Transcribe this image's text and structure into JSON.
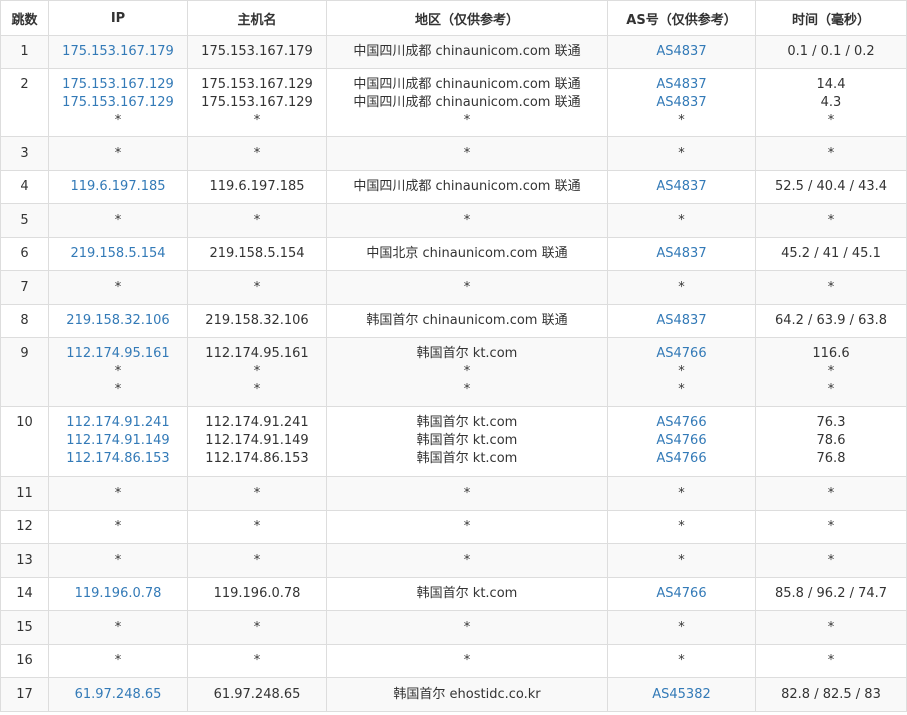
{
  "table": {
    "headers": [
      "跳数",
      "IP",
      "主机名",
      "地区（仅供参考）",
      "AS号（仅供参考）",
      "时间（毫秒）"
    ],
    "rows": [
      {
        "hop": "1",
        "ip": [
          "175.153.167.179"
        ],
        "host": [
          "175.153.167.179"
        ],
        "region": [
          "中国四川成都 chinaunicom.com 联通"
        ],
        "asn": [
          "AS4837"
        ],
        "time": [
          "0.1 / 0.1 / 0.2"
        ]
      },
      {
        "hop": "2",
        "ip": [
          "175.153.167.129",
          "175.153.167.129",
          "*"
        ],
        "host": [
          "175.153.167.129",
          "175.153.167.129",
          "*"
        ],
        "region": [
          "中国四川成都 chinaunicom.com 联通",
          "中国四川成都 chinaunicom.com 联通",
          "*"
        ],
        "asn": [
          "AS4837",
          "AS4837",
          "*"
        ],
        "time": [
          "14.4",
          "4.3",
          "*"
        ]
      },
      {
        "hop": "3",
        "ip": [
          "*"
        ],
        "host": [
          "*"
        ],
        "region": [
          "*"
        ],
        "asn": [
          "*"
        ],
        "time": [
          "*"
        ]
      },
      {
        "hop": "4",
        "ip": [
          "119.6.197.185"
        ],
        "host": [
          "119.6.197.185"
        ],
        "region": [
          "中国四川成都 chinaunicom.com 联通"
        ],
        "asn": [
          "AS4837"
        ],
        "time": [
          "52.5 / 40.4 / 43.4"
        ]
      },
      {
        "hop": "5",
        "ip": [
          "*"
        ],
        "host": [
          "*"
        ],
        "region": [
          "*"
        ],
        "asn": [
          "*"
        ],
        "time": [
          "*"
        ]
      },
      {
        "hop": "6",
        "ip": [
          "219.158.5.154"
        ],
        "host": [
          "219.158.5.154"
        ],
        "region": [
          "中国北京 chinaunicom.com 联通"
        ],
        "asn": [
          "AS4837"
        ],
        "time": [
          "45.2 / 41 / 45.1"
        ]
      },
      {
        "hop": "7",
        "ip": [
          "*"
        ],
        "host": [
          "*"
        ],
        "region": [
          "*"
        ],
        "asn": [
          "*"
        ],
        "time": [
          "*"
        ]
      },
      {
        "hop": "8",
        "ip": [
          "219.158.32.106"
        ],
        "host": [
          "219.158.32.106"
        ],
        "region": [
          "韩国首尔 chinaunicom.com 联通"
        ],
        "asn": [
          "AS4837"
        ],
        "time": [
          "64.2 / 63.9 / 63.8"
        ]
      },
      {
        "hop": "9",
        "ip": [
          "112.174.95.161",
          "*",
          "*"
        ],
        "host": [
          "112.174.95.161",
          "*",
          "*"
        ],
        "region": [
          "韩国首尔 kt.com",
          "*",
          "*"
        ],
        "asn": [
          "AS4766",
          "*",
          "*"
        ],
        "time": [
          "116.6",
          "*",
          "*"
        ]
      },
      {
        "hop": "10",
        "ip": [
          "112.174.91.241",
          "112.174.91.149",
          "112.174.86.153"
        ],
        "host": [
          "112.174.91.241",
          "112.174.91.149",
          "112.174.86.153"
        ],
        "region": [
          "韩国首尔 kt.com",
          "韩国首尔 kt.com",
          "韩国首尔 kt.com"
        ],
        "asn": [
          "AS4766",
          "AS4766",
          "AS4766"
        ],
        "time": [
          "76.3",
          "78.6",
          "76.8"
        ]
      },
      {
        "hop": "11",
        "ip": [
          "*"
        ],
        "host": [
          "*"
        ],
        "region": [
          "*"
        ],
        "asn": [
          "*"
        ],
        "time": [
          "*"
        ]
      },
      {
        "hop": "12",
        "ip": [
          "*"
        ],
        "host": [
          "*"
        ],
        "region": [
          "*"
        ],
        "asn": [
          "*"
        ],
        "time": [
          "*"
        ]
      },
      {
        "hop": "13",
        "ip": [
          "*"
        ],
        "host": [
          "*"
        ],
        "region": [
          "*"
        ],
        "asn": [
          "*"
        ],
        "time": [
          "*"
        ]
      },
      {
        "hop": "14",
        "ip": [
          "119.196.0.78"
        ],
        "host": [
          "119.196.0.78"
        ],
        "region": [
          "韩国首尔 kt.com"
        ],
        "asn": [
          "AS4766"
        ],
        "time": [
          "85.8 / 96.2 / 74.7"
        ]
      },
      {
        "hop": "15",
        "ip": [
          "*"
        ],
        "host": [
          "*"
        ],
        "region": [
          "*"
        ],
        "asn": [
          "*"
        ],
        "time": [
          "*"
        ]
      },
      {
        "hop": "16",
        "ip": [
          "*"
        ],
        "host": [
          "*"
        ],
        "region": [
          "*"
        ],
        "asn": [
          "*"
        ],
        "time": [
          "*"
        ]
      },
      {
        "hop": "17",
        "ip": [
          "61.97.248.65"
        ],
        "host": [
          "61.97.248.65"
        ],
        "region": [
          "韩国首尔 ehostidc.co.kr"
        ],
        "asn": [
          "AS45382"
        ],
        "time": [
          "82.8 / 82.5 / 83"
        ]
      }
    ]
  },
  "colors": {
    "link": "#337ab7",
    "text": "#333333",
    "border": "#dddddd",
    "stripe": "#f9f9f9"
  }
}
